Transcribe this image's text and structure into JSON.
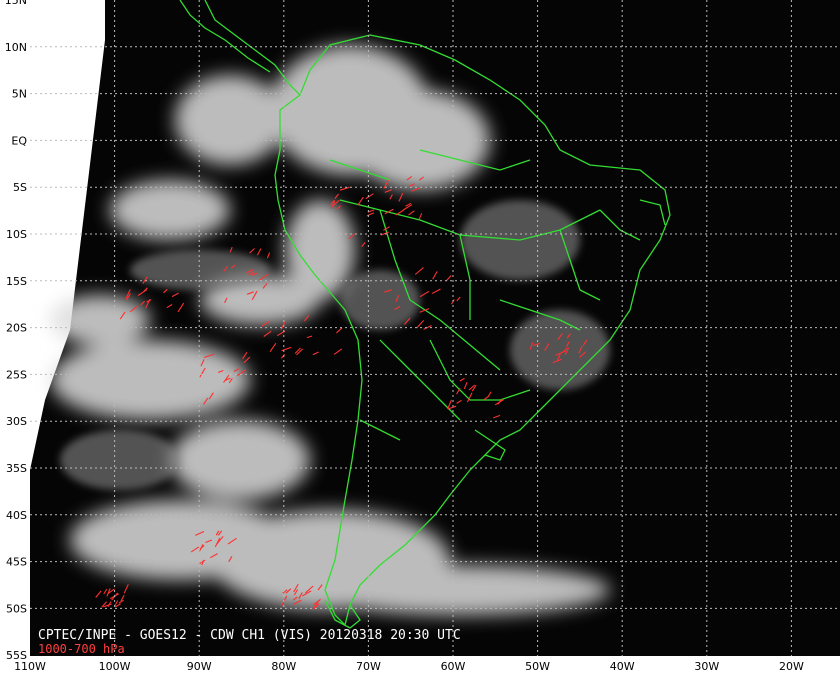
{
  "map": {
    "lat_labels": [
      "15N",
      "10N",
      "5N",
      "EQ",
      "5S",
      "10S",
      "15S",
      "20S",
      "25S",
      "30S",
      "35S",
      "40S",
      "45S",
      "50S",
      "55S"
    ],
    "lon_labels": [
      "110W",
      "100W",
      "90W",
      "80W",
      "70W",
      "60W",
      "50W",
      "40W",
      "30W",
      "20W"
    ],
    "overlay": {
      "title": "CPTEC/INPE - GOES12 - CDW CH1 (VIS) 20120318 20:30 UTC",
      "layer": "1000-700 hPa"
    },
    "colors": {
      "background": "#000000",
      "coastline": "#33dd33",
      "wind_vectors": "#ff3030",
      "grid": "#cccccc",
      "clouds": "#e8e8e8"
    }
  }
}
